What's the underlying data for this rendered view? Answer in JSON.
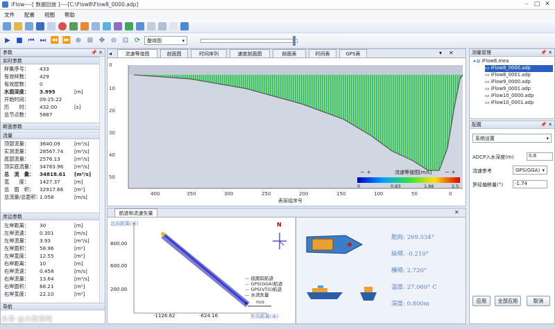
{
  "window": {
    "title": "iFlow----[ 数据回放 ]----[C:\\Flow8\\Flow8_0000.adp]"
  },
  "menu": [
    "文件",
    "配置",
    "视图",
    "帮助"
  ],
  "toolbar": {
    "view_select": "整体图"
  },
  "left": {
    "header": "参数",
    "realtime_title": "实时参数",
    "realtime": [
      {
        "label": "样集序号：",
        "value": "433",
        "unit": ""
      },
      {
        "label": "有效样数：",
        "value": "429",
        "unit": ""
      },
      {
        "label": "有效层数：",
        "value": "0",
        "unit": ""
      },
      {
        "label": "水面深度：",
        "value": "3.995",
        "unit": "[m]"
      },
      {
        "label": "开始时间：",
        "value": "09:25:22",
        "unit": ""
      },
      {
        "label": "历　　时：",
        "value": "432.00",
        "unit": "[s]"
      },
      {
        "label": "总节点数：",
        "value": "5887",
        "unit": ""
      }
    ],
    "section_title": "断面参数",
    "flow_title": "流量",
    "flow": [
      {
        "label": "顶部流量：",
        "value": "3640.09",
        "unit": "[m³/s]"
      },
      {
        "label": "实测流量：",
        "value": "28567.74",
        "unit": "[m³/s]"
      },
      {
        "label": "底部流量：",
        "value": "2576.13",
        "unit": "[m³/s]"
      },
      {
        "label": "顶实底流量：",
        "value": "34783.96",
        "unit": "[m³/s]"
      },
      {
        "label": "总　流　量：",
        "value": "34818.61",
        "unit": "[m³/s]"
      },
      {
        "label": "宽　　度：",
        "value": "1427.37",
        "unit": "[m]"
      },
      {
        "label": "总　面　积：",
        "value": "32917.66",
        "unit": "[m²]"
      },
      {
        "label": "总流量/总面积：",
        "value": "1.058",
        "unit": "[m/s]"
      }
    ],
    "bank_title": "岸边参数",
    "bank": [
      {
        "label": "左岸距离：",
        "value": "30",
        "unit": "[m]"
      },
      {
        "label": "左岸流速：",
        "value": "0.301",
        "unit": "[m/s]"
      },
      {
        "label": "左岸流量：",
        "value": "3.93",
        "unit": "[m³/s]"
      },
      {
        "label": "左岸面积：",
        "value": "58.96",
        "unit": "[m²]"
      },
      {
        "label": "左岸宽度：",
        "value": "12.55",
        "unit": "[m²]"
      },
      {
        "label": "右岸距离：",
        "value": "10",
        "unit": "[m]"
      },
      {
        "label": "右岸流速：",
        "value": "0.458",
        "unit": "[m/s]"
      },
      {
        "label": "右岸流量：",
        "value": "13.64",
        "unit": "[m³/s]"
      },
      {
        "label": "右岸面积：",
        "value": "68.21",
        "unit": "[m²]"
      },
      {
        "label": "右岸宽度：",
        "value": "22.10",
        "unit": "[m²]"
      }
    ],
    "nav_title": "导航"
  },
  "tabs": [
    "流速等值图",
    "剖面图",
    "时间序列",
    "速度剖面图",
    "剖面表",
    "时间表",
    "GPS表"
  ],
  "contour": {
    "y_ticks": [
      "0",
      "10",
      "20",
      "30",
      "40",
      "50"
    ],
    "x_ticks": [
      "400",
      "350",
      "300",
      "250",
      "200",
      "150",
      "100",
      "50",
      "0"
    ],
    "x_axis_label": "表层组序号",
    "legend_title": "流速等值图[m/s]",
    "legend_min": "0",
    "legend_mid1": "0.83",
    "legend_mid2": "1.66",
    "legend_max": "2.5"
  },
  "track": {
    "panel_title": "航迹和流速矢量",
    "y_axis_title": "北向距离(米)",
    "y_ticks": [
      "800.00",
      "600.00",
      "200.00"
    ],
    "x_ticks": [
      "-1126.62",
      "-624.16"
    ],
    "x_axis_title": "东向距离(米)",
    "north_label": "N",
    "legend": [
      "底跟踪航迹",
      "GPS(GGA)航迹",
      "GPS(VTG)航迹",
      "水流矢量"
    ],
    "scale_label": "m/s"
  },
  "nav": {
    "heading": "航向: 269.534°",
    "pitch": "纵倾: -0.210°",
    "roll": "横倾: 2.720°",
    "temperature": "温度: 27.060° C",
    "depth": "深度: 0.800m"
  },
  "files": {
    "header": "测量管理",
    "root": "iFlow8.mea",
    "items": [
      "iFlow8_0000.adp",
      "iFlow8_0001.adp",
      "iFlow9_0000.adp",
      "iFlow9_0001.adp",
      "iFlow10_0000.adp",
      "iFlow10_0001.adp"
    ]
  },
  "config": {
    "header": "配置",
    "dropdown": "系统设置",
    "adcp_label": "ADCP入水深度(m)",
    "adcp_value": "0.8",
    "ref_label": "流速参考",
    "ref_value": "GPS(GGA)",
    "compass_label": "罗经偏移量(°)",
    "compass_value": "-1.74",
    "apply": "应用",
    "apply_all": "全部应用",
    "cancel": "取消"
  },
  "watermark": "头条 @大数流域",
  "colors": {
    "accent": "#1b4fc4",
    "panel_border": "#a9b7cc",
    "red_val": "#d00000"
  }
}
